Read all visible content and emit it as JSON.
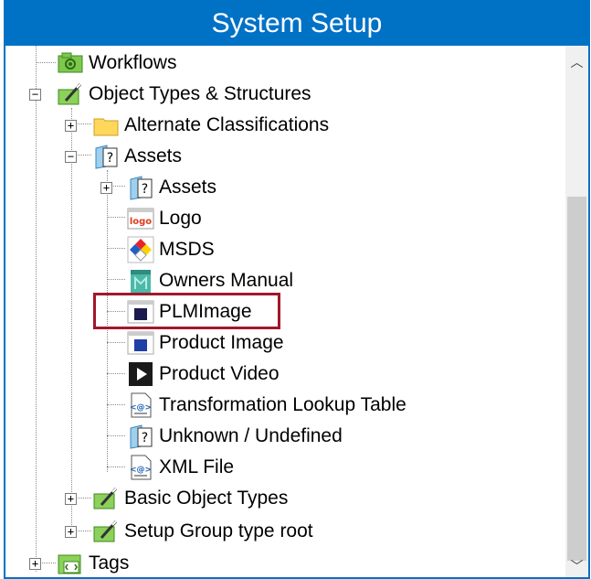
{
  "window": {
    "title": "System Setup"
  },
  "tree": {
    "workflows": "Workflows",
    "object_types": "Object Types & Structures",
    "alternate_classifications": "Alternate Classifications",
    "assets_group": "Assets",
    "assets_child": "Assets",
    "logo": "Logo",
    "msds": "MSDS",
    "owners_manual": "Owners Manual",
    "plmimage": "PLMImage",
    "product_image": "Product Image",
    "product_video": "Product Video",
    "transformation_lookup": "Transformation Lookup Table",
    "unknown": "Unknown / Undefined",
    "xml_file": "XML File",
    "basic_object_types": "Basic Object Types",
    "setup_group": "Setup Group type root",
    "tags": "Tags"
  },
  "icons": {
    "logo_text": "logo",
    "question": "?",
    "xml_text": "<@>"
  },
  "colors": {
    "title_bar": "#0072c6",
    "highlight": "#a0182a"
  }
}
